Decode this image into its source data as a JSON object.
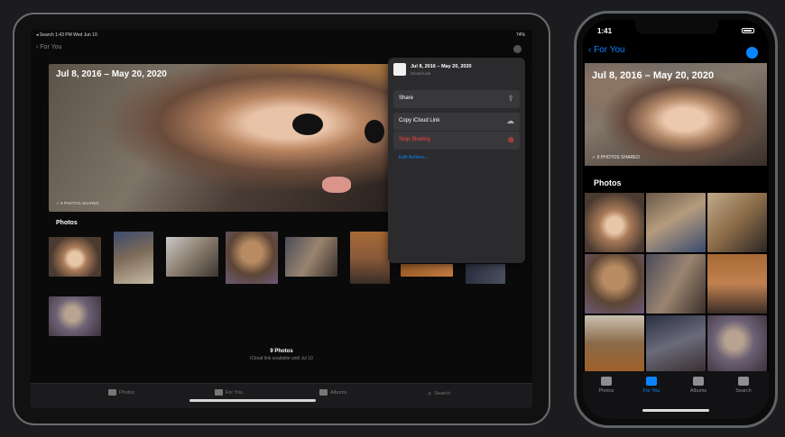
{
  "ipad": {
    "status_left": "◂ Search   1:43 PM   Wed Jun 10",
    "status_right": "74%",
    "back_label": "For You",
    "hero_title": "Jul 8, 2016 – May 20, 2020",
    "hero_shared": "✓ 9 PHOTOS SHARED",
    "section_title": "Photos",
    "footer_count": "9 Photos",
    "footer_sub": "iCloud link available until Jul 10",
    "tabs": [
      {
        "label": "Photos",
        "icon": "photos-icon"
      },
      {
        "label": "For You",
        "icon": "for-you-icon"
      },
      {
        "label": "Albums",
        "icon": "albums-icon"
      },
      {
        "label": "Search",
        "icon": "search-icon"
      }
    ]
  },
  "popup": {
    "title": "Jul 8, 2016 – May 20, 2020",
    "subtitle": "iCloud Link",
    "rows": [
      {
        "label": "Share",
        "icon": "share-icon"
      },
      {
        "label": "Copy iCloud Link",
        "icon": "cloud-icon"
      },
      {
        "label": "Stop Sharing",
        "icon": "x-circle-icon"
      }
    ],
    "edit_label": "Edit Actions...",
    "colors": {
      "destructive": "#ff453a",
      "accent": "#0a84ff"
    }
  },
  "iphone": {
    "time": "1:41",
    "back_label": "For You",
    "hero_title": "Jul 8, 2016 – May 20, 2020",
    "hero_shared": "✓ 9 PHOTOS SHARED",
    "section_title": "Photos",
    "tabs": [
      {
        "label": "Photos",
        "active": false
      },
      {
        "label": "For You",
        "active": true
      },
      {
        "label": "Albums",
        "active": false
      },
      {
        "label": "Search",
        "active": false
      }
    ]
  }
}
